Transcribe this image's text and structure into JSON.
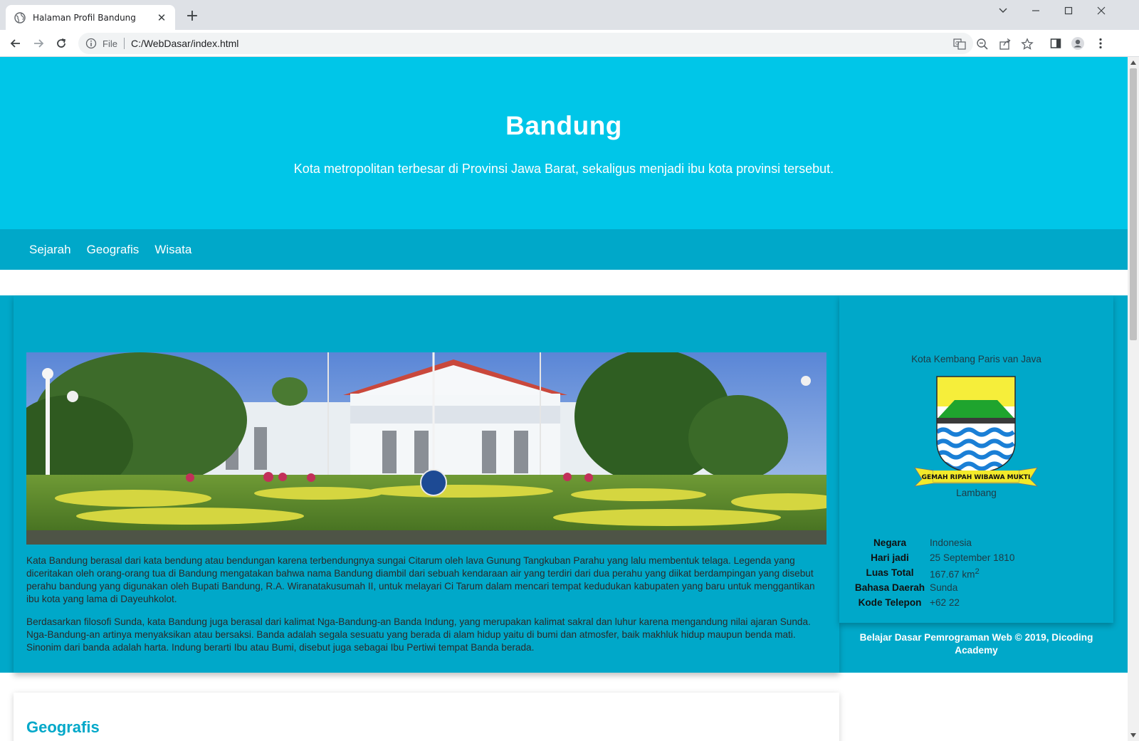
{
  "browser": {
    "tab_title": "Halaman Profil Bandung",
    "tab_close": "✕",
    "new_tab": "+",
    "omnibox_scheme": "File",
    "omnibox_url": "C:/WebDasar/index.html"
  },
  "page": {
    "hero": {
      "title": "Bandung",
      "subtitle": "Kota metropolitan terbesar di Provinsi Jawa Barat, sekaligus menjadi ibu kota provinsi tersebut."
    },
    "nav": [
      "Sejarah",
      "Geografis",
      "Wisata"
    ],
    "article": {
      "paragraphs": [
        "Kata Bandung berasal dari kata bendung atau bendungan karena terbendungnya sungai Citarum oleh lava Gunung Tangkuban Parahu yang lalu membentuk telaga. Legenda yang diceritakan oleh orang-orang tua di Bandung mengatakan bahwa nama Bandung diambil dari sebuah kendaraan air yang terdiri dari dua perahu yang diikat berdampingan yang disebut perahu bandung yang digunakan oleh Bupati Bandung, R.A. Wiranatakusumah II, untuk melayari Ci Tarum dalam mencari tempat kedudukan kabupaten yang baru untuk menggantikan ibu kota yang lama di Dayeuhkolot.",
        "Berdasarkan filosofi Sunda, kata Bandung juga berasal dari kalimat Nga-Bandung-an Banda Indung, yang merupakan kalimat sakral dan luhur karena mengandung nilai ajaran Sunda. Nga-Bandung-an artinya menyaksikan atau bersaksi. Banda adalah segala sesuatu yang berada di alam hidup yaitu di bumi dan atmosfer, baik makhluk hidup maupun benda mati. Sinonim dari banda adalah harta. Indung berarti Ibu atau Bumi, disebut juga sebagai Ibu Pertiwi tempat Banda berada."
      ]
    },
    "aside": {
      "tagline": "Kota Kembang Paris van Java",
      "emblem_motto": "GEMAH RIPAH WIBAWA MUKTI",
      "emblem_caption": "Lambang",
      "info": [
        {
          "key": "Negara",
          "value": "Indonesia"
        },
        {
          "key": "Hari jadi",
          "value": "25 September 1810"
        },
        {
          "key": "Luas Total",
          "value": "167.67 km",
          "sup": "2"
        },
        {
          "key": "Bahasa Daerah",
          "value": "Sunda"
        },
        {
          "key": "Kode Telepon",
          "value": "+62 22"
        }
      ],
      "footer": "Belajar Dasar Pemrograman Web © 2019, Dicoding Academy"
    },
    "section2_title": "Geografis"
  },
  "colors": {
    "hero_bg": "#00c6e8",
    "nav_bg": "#00a8c9",
    "heading_accent": "#00a8c9"
  }
}
